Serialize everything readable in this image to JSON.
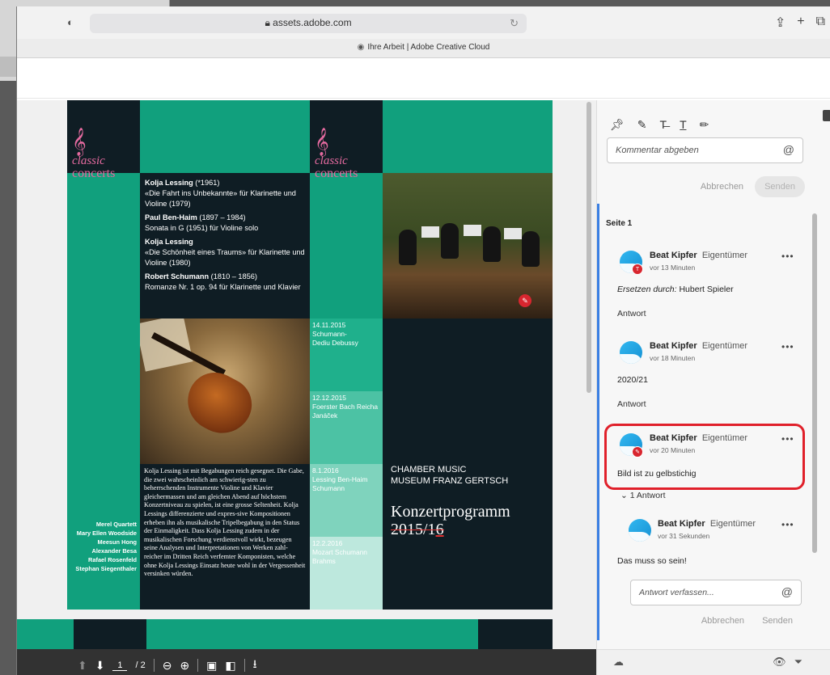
{
  "browser": {
    "url": "assets.adobe.com",
    "tab_title": "Ihre Arbeit | Adobe Creative Cloud"
  },
  "document": {
    "logo": {
      "line1": "classic",
      "line2": "concerts"
    },
    "program": [
      {
        "composer": "Kolja Lessing",
        "years": " (*1961)",
        "work": "«Die Fahrt ins Unbekannte» für Klarinette und Violine (1979)"
      },
      {
        "composer": "Paul Ben-Haim",
        "years": " (1897 – 1984)",
        "work": "Sonata in G (1951) für Violine solo"
      },
      {
        "composer": "Kolja Lessing",
        "years": "",
        "work": "«Die Schönheit eines Traums» für Klarinette und Violine (1980)"
      },
      {
        "composer": "Robert Schumann",
        "years": " (1810 – 1856)",
        "work": "Romanze Nr. 1 op. 94 für Klarinette und Klavier"
      }
    ],
    "dates": [
      {
        "date": "14.11.2015",
        "text": "Schumann-\nDediu Debussy"
      },
      {
        "date": "12.12.2015",
        "text": "Foerster Bach Reicha\nJanáček"
      },
      {
        "date": "8.1.2016",
        "text": "Lessing Ben-Haim\nSchumann"
      },
      {
        "date": "12.2.2016",
        "text": "Mozart Schumann\nBrahms"
      }
    ],
    "bio": "Kolja Lessing ist mit Begabungen reich gesegnet. Die Gabe, die zwei wahrscheinlich am schwierig-sten zu beherrschenden Instrumente Violine und Klavier gleichermassen und am gleichen Abend auf höchstem Konzertniveau zu spielen, ist eine grosse Seltenheit. Kolja Lessings differenzierte und expres-sive Kompositionen erheben ihn als musikalische Tripelbegabung in den Status der Einmaligkeit. Dass Kolja Lessing zudem in der musikalischen Forschung verdienstvoll wirkt, bezeugen seine Analysen und Interpretationen von Werken zahl-reicher im Dritten Reich verfemter Komponisten, welche ohne Kolja Lessings Einsatz heute wohl in der Vergessenheit versinken würden.",
    "performers": [
      "Merel Quartett",
      "Mary Ellen Woodside",
      "Meesun Hong",
      "Alexander Besa",
      "Rafael Rosenfeld",
      "Stephan Siegenthaler"
    ],
    "chamber": [
      "CHAMBER MUSIC",
      "MUSEUM FRANZ GERTSCH"
    ],
    "konzert_title": "Konzertprogramm",
    "season_prefix": "2015/1",
    "season_suffix": "6"
  },
  "viewer": {
    "page_current": "1",
    "page_total": "/ 2"
  },
  "comments": {
    "input_placeholder": "Kommentar abgeben",
    "cancel": "Abbrechen",
    "send": "Senden",
    "section": "Seite 1",
    "items": [
      {
        "author": "Beat Kipfer",
        "role": "Eigentümer",
        "time": "vor 13 Minuten",
        "prefix": "Ersetzen durch:",
        "text": " Hubert Spieler",
        "reply": "Antwort"
      },
      {
        "author": "Beat Kipfer",
        "role": "Eigentümer",
        "time": "vor 18 Minuten",
        "text": "2020/21",
        "reply": "Antwort"
      },
      {
        "author": "Beat Kipfer",
        "role": "Eigentümer",
        "time": "vor 20 Minuten",
        "text": "Bild ist zu gelbstichig",
        "replies_toggle": "1 Antwort"
      },
      {
        "author": "Beat Kipfer",
        "role": "Eigentümer",
        "time": "vor 31 Sekunden",
        "text": "Das muss so sein!"
      }
    ],
    "reply_placeholder": "Antwort verfassen...",
    "reply_cancel": "Abbrechen",
    "reply_send": "Senden"
  },
  "colors": {
    "teal": "#11a07d",
    "dark": "#0f1d24",
    "pink": "#e46a9f",
    "highlight": "#e0202a",
    "blue_bar": "#3a7fe3"
  }
}
